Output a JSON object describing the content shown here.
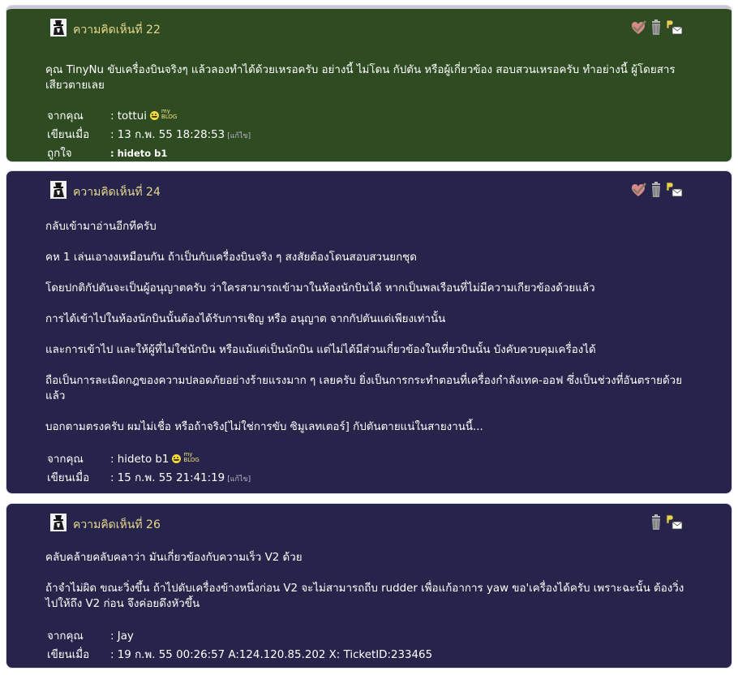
{
  "colors": {
    "green_card": "#2e4b21",
    "navy_card": "#26244a",
    "title_text": "#e9d98e",
    "body_text": "#ffffff"
  },
  "labels": {
    "from": "จากคุณ",
    "written": "เขียนเมื่อ",
    "liked": "ถูกใจ",
    "edit": "[แก้ไข]",
    "myblog_top": "my",
    "myblog_bottom": "BLOG"
  },
  "icons": {
    "avatar": "hat-avatar-icon",
    "approve": "check-heart-icon",
    "delete": "trash-icon",
    "pm": "send-message-icon"
  },
  "comments": [
    {
      "title": "ความคิดเห็นที่ 22",
      "paragraphs": [
        "คุณ TinyNu ขับเครื่องบินจริงๆ แล้วลองทำได้ด้วยเหรอครับ อย่างนี้ ไม่โดน กัปตัน หรือผู้เกี่ยวข้อง สอบสวนเหรอครับ ทำอย่างนี้ ผู้โดยสารเสียวตายเลย"
      ],
      "author": ": tottui",
      "written": ": 13 ก.พ. 55 18:28:53",
      "liked": ": hideto b1"
    },
    {
      "title": "ความคิดเห็นที่ 24",
      "paragraphs": [
        "กลับเข้ามาอ่านอีกทีครับ",
        "คห 1 เล่นเอางงเหมือนกัน ถ้าเป็นกับเครื่องบินจริง ๆ สงสัยต้องโดนสอบสวนยกชุด",
        "โดยปกติกัปตันจะเป็นผู้อนุญาตครับ ว่าใครสามารถเข้ามาในห้องนักบินได้ หากเป็นพลเรือนที่ไม่มีความเกียวข้องด้วยแล้ว",
        "การได้เข้าไปในห้องนักบินนั้นต้องได้รับการเชิญ หรือ อนุญาต จากกัปตันแต่เพียงเท่านั้น",
        "และการเข้าไป และให้ผู้ที่ไม่ใช่นักบิน หรือแม้แต่เป็นนักบิน แต่ไม่ได้มีส่วนเกี่ยวข้องในเที่ยวบินนั้น บังคับควบคุมเครื่องได้",
        "ถือเป็นการละเมิดกฎของความปลอดภัยอย่างร้ายแรงมาก ๆ เลยครับ ยิ่งเป็นการกระทำตอนที่เครื่องกำลังเทค-ออฟ ซึ่งเป็นช่วงที่อันตรายด้วยแล้ว",
        "บอกตามตรงครับ ผมไม่เชื่อ หรือถ้าจริง[ไม่ใช่การขับ ซิมูเลทเตอร์] กัปตันตายแน่ในสายงานนี้..."
      ],
      "author": ": hideto b1",
      "written": ": 15 ก.พ. 55 21:41:19"
    },
    {
      "title": "ความคิดเห็นที่ 26",
      "paragraphs": [
        "คลับคล้ายคลับคลาว่า มันเกี่ยวข้องกับความเร็ว V2 ด้วย",
        "ถ้าจำไม่ผิด ขณะวิ่งขึ้น ถ้าไปดับเครื่องข้างหนึ่งก่อน V2 จะไม่สามารถถีบ rudder เพื่อแก้อาการ yaw ขอ'เครื่องได้ครับ เพราะฉะนั้น ต้องวิ่งไปให้ถึง V2 ก่อน จึงค่อยดึงหัวขึ้น"
      ],
      "author": ": Jay",
      "written": ": 19 ก.พ. 55 00:26:57 A:124.120.85.202 X: TicketID:233465"
    }
  ]
}
